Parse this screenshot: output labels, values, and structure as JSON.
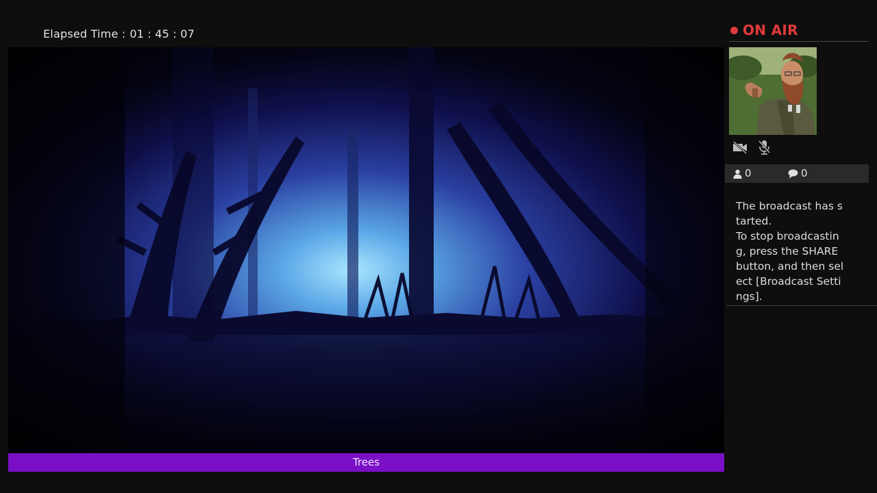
{
  "header": {
    "elapsed_label": "Elapsed Time :",
    "elapsed_value": "01 : 45 : 07"
  },
  "game": {
    "subtitle": "Trees",
    "accent_color": "#7a0fc6"
  },
  "broadcast": {
    "status_label": "ON AIR",
    "status_color": "#e23a3a",
    "camera_icon": "camera-off-icon",
    "mic_icon": "mic-off-icon",
    "viewers_icon": "person-icon",
    "viewers_count": "0",
    "comments_icon": "speech-bubble-icon",
    "comments_count": "0",
    "message_line1": "The broadcast has started.",
    "message_line2": "To stop broadcasting, press the SHARE button, and then select [Broadcast Settings]."
  }
}
